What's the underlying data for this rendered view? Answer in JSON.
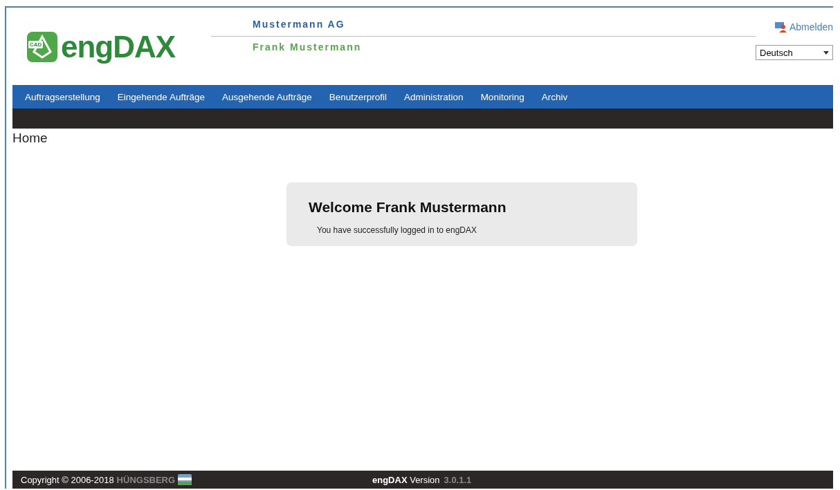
{
  "header": {
    "logo_text": "engDAX",
    "logo_badge": "CAD",
    "company": "Mustermann AG",
    "user": "Frank Mustermann",
    "logout": "Abmelden",
    "language": {
      "value": "Deutsch"
    }
  },
  "nav": [
    "Auftragserstellung",
    "Eingehende Aufträge",
    "Ausgehende Aufträge",
    "Benutzerprofil",
    "Administration",
    "Monitoring",
    "Archiv"
  ],
  "page_title": "Home",
  "welcome": {
    "title": "Welcome Frank Mustermann",
    "message": "You have successfully logged in to engDAX"
  },
  "footer": {
    "copyright": "Copyright © 2006-2018",
    "brand": "HÜNGSBERG",
    "version_label": "**engDAX** Version",
    "version": "3.0.1.1"
  }
}
